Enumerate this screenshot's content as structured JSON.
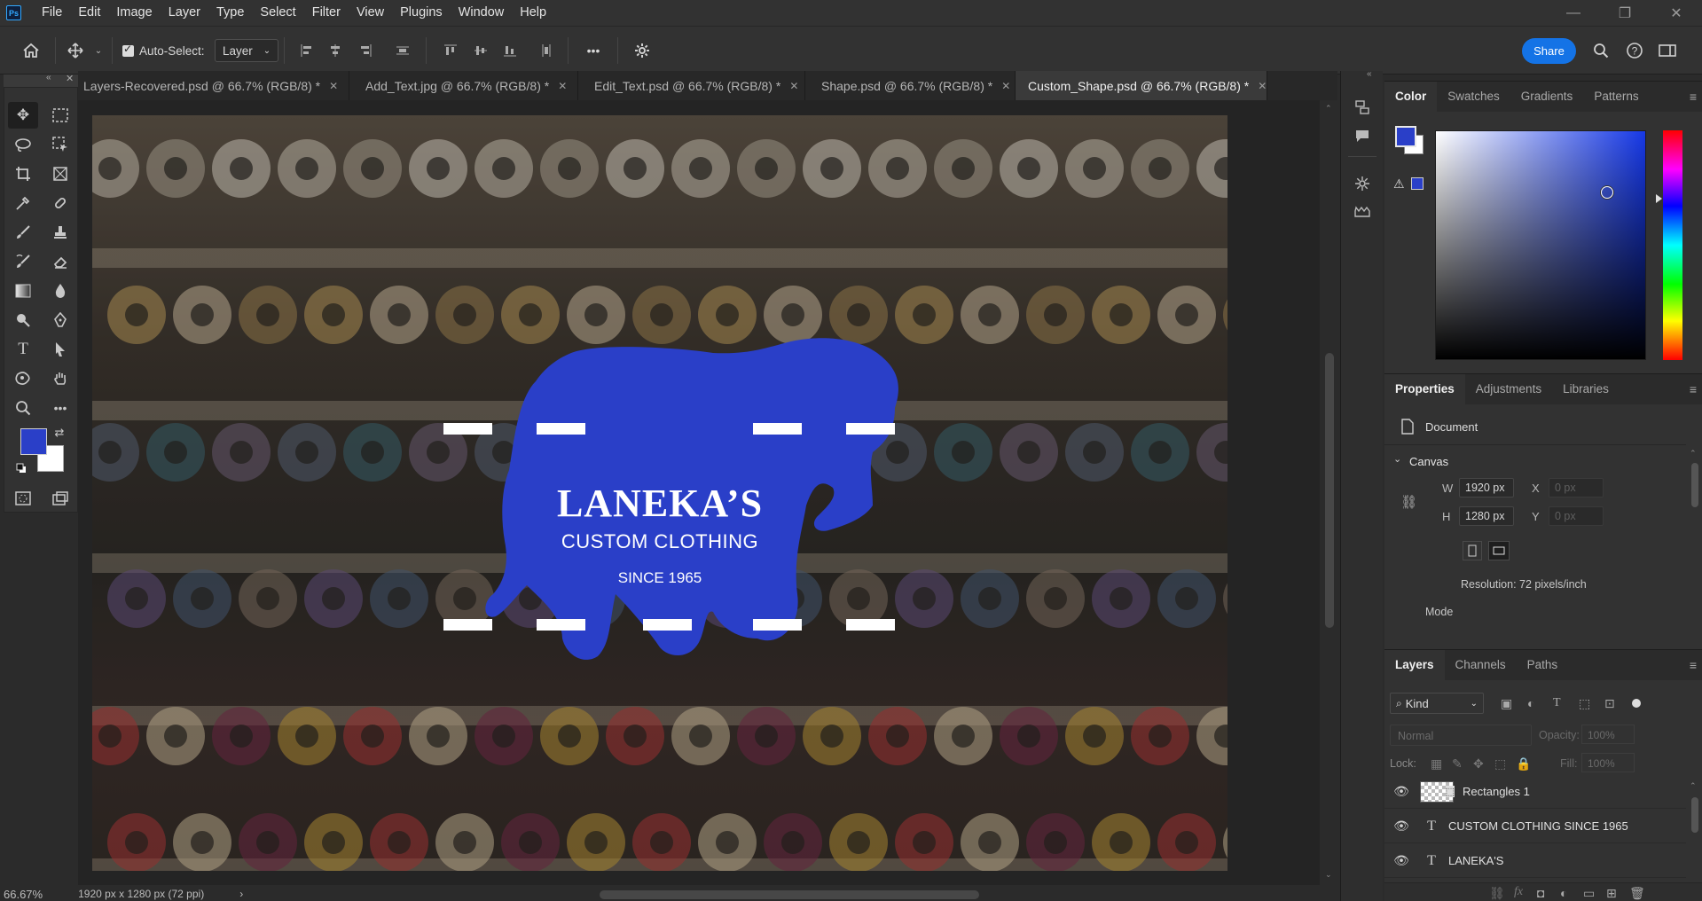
{
  "app": {
    "logo_text": "Ps",
    "accent": "#1473e6"
  },
  "menu": [
    "File",
    "Edit",
    "Image",
    "Layer",
    "Type",
    "Select",
    "Filter",
    "View",
    "Plugins",
    "Window",
    "Help"
  ],
  "window_controls": {
    "minimize": "—",
    "maximize": "❐",
    "close": "✕"
  },
  "options_bar": {
    "auto_select_label": "Auto-Select:",
    "auto_select_checked": true,
    "auto_select_target": "Layer",
    "share_label": "Share",
    "more_label": "•••"
  },
  "tabs": [
    {
      "label": "Layers-Recovered.psd @ 66.7% (RGB/8) *",
      "active": false
    },
    {
      "label": "Add_Text.jpg @ 66.7% (RGB/8) *",
      "active": false
    },
    {
      "label": "Edit_Text.psd @ 66.7% (RGB/8) *",
      "active": false
    },
    {
      "label": "Shape.psd @ 66.7% (RGB/8) *",
      "active": false
    },
    {
      "label": "Custom_Shape.psd @ 66.7% (RGB/8) *",
      "active": true
    }
  ],
  "tab_close": "✕",
  "canvas": {
    "title": "LANEKA’S",
    "subtitle": "CUSTOM CLOTHING",
    "since": "SINCE 1965",
    "shape_color": "#2a3fc8",
    "shape_name": "bear-shape"
  },
  "colors": {
    "foreground": "#2a3fc8",
    "background": "#ffffff"
  },
  "color_panel": {
    "tabs": [
      "Color",
      "Swatches",
      "Gradients",
      "Patterns"
    ],
    "active": "Color"
  },
  "properties_panel": {
    "tabs": [
      "Properties",
      "Adjustments",
      "Libraries"
    ],
    "active": "Properties",
    "doc_label": "Document",
    "section": "Canvas",
    "w_label": "W",
    "w_value": "1920 px",
    "h_label": "H",
    "h_value": "1280 px",
    "x_label": "X",
    "x_placeholder": "0 px",
    "y_label": "Y",
    "y_placeholder": "0 px",
    "resolution": "Resolution: 72 pixels/inch",
    "mode_label": "Mode"
  },
  "layers_panel": {
    "tabs": [
      "Layers",
      "Channels",
      "Paths"
    ],
    "active": "Layers",
    "filter_label": "Kind",
    "blend_mode": "Normal",
    "opacity_label": "Opacity:",
    "opacity_value": "100%",
    "lock_label": "Lock:",
    "fill_label": "Fill:",
    "fill_value": "100%",
    "layers": [
      {
        "name": "Rectangles 1",
        "kind": "shape"
      },
      {
        "name": "CUSTOM CLOTHING  SINCE 1965",
        "kind": "text"
      },
      {
        "name": "LANEKA'S",
        "kind": "text"
      }
    ]
  },
  "status_bar": {
    "zoom": "66.67%",
    "doc_info": "1920 px x 1280 px (72 ppi)",
    "arrow": "›"
  }
}
